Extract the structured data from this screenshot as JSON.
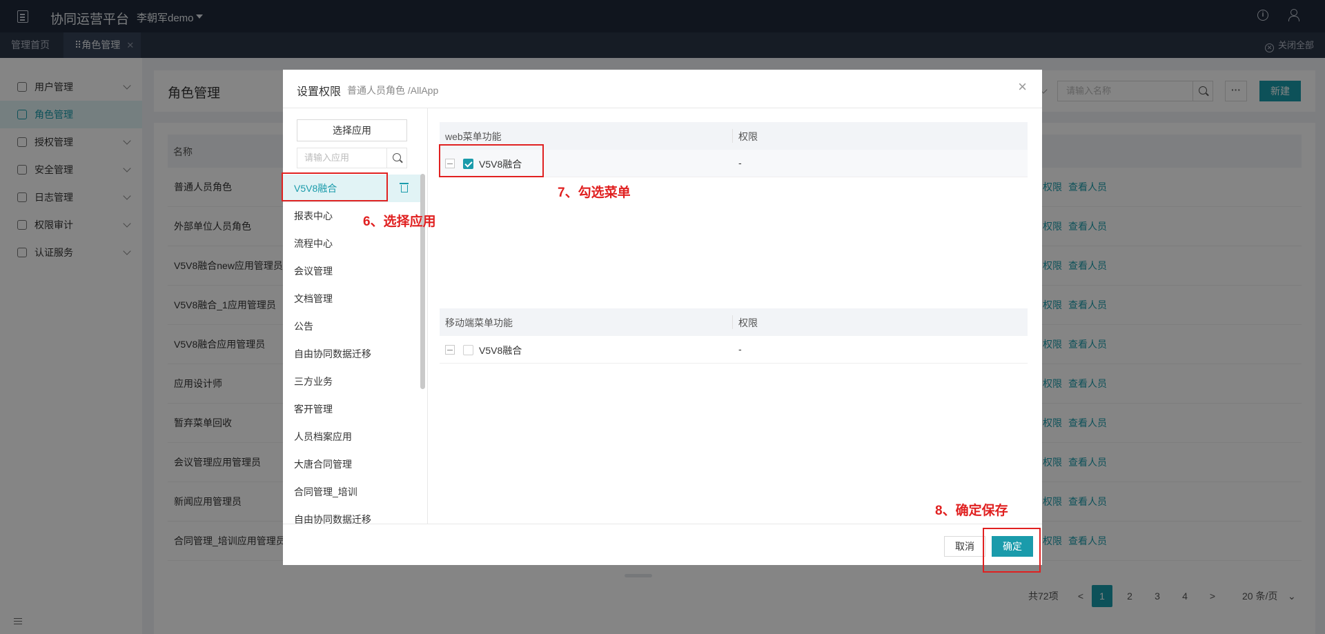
{
  "topbar": {
    "app_title": "协同运营平台",
    "user_name": "李朝军demo",
    "info_icon": "info-circle-icon",
    "user_icon": "user-icon"
  },
  "tabs": {
    "home": "管理首页",
    "active": "角色管理",
    "close_all": "关闭全部"
  },
  "sidebar": {
    "items": [
      {
        "label": "用户管理",
        "icon": "user-icon"
      },
      {
        "label": "角色管理",
        "icon": "shield-icon"
      },
      {
        "label": "授权管理",
        "icon": "key-icon"
      },
      {
        "label": "安全管理",
        "icon": "shield-icon"
      },
      {
        "label": "日志管理",
        "icon": "monitor-icon"
      },
      {
        "label": "权限审计",
        "icon": "user-icon"
      },
      {
        "label": "认证服务",
        "icon": "badge-icon"
      }
    ]
  },
  "main": {
    "page_title": "角色管理",
    "search_placeholder": "请输入名称",
    "more_label": "···",
    "new_label": "新建",
    "column_name": "名称",
    "rows": [
      {
        "name": "普通人员角色",
        "perm": "权限",
        "view": "查看人员"
      },
      {
        "name": "外部单位人员角色",
        "perm": "权限",
        "view": "查看人员"
      },
      {
        "name": "V5V8融合new应用管理员",
        "perm": "权限",
        "view": "查看人员"
      },
      {
        "name": "V5V8融合_1应用管理员",
        "perm": "权限",
        "view": "查看人员"
      },
      {
        "name": "V5V8融合应用管理员",
        "perm": "权限",
        "view": "查看人员"
      },
      {
        "name": "应用设计师",
        "perm": "权限",
        "view": "查看人员"
      },
      {
        "name": "暂弃菜单回收",
        "perm": "权限",
        "view": "查看人员"
      },
      {
        "name": "会议管理应用管理员",
        "perm": "权限",
        "view": "查看人员"
      },
      {
        "name": "新闻应用管理员",
        "perm": "权限",
        "view": "查看人员"
      },
      {
        "name": "合同管理_培训应用管理员",
        "perm": "权限",
        "view": "查看人员"
      }
    ],
    "pager": {
      "total": "共72项",
      "prev": "<",
      "pages": [
        "1",
        "2",
        "3",
        "4"
      ],
      "current": "1",
      "next": ">",
      "page_size": "20 条/页"
    }
  },
  "modal": {
    "title": "设置权限",
    "subtitle": "普通人员角色 /AllApp",
    "close": "×",
    "select_app_label": "选择应用",
    "app_search_placeholder": "请输入应用",
    "apps": [
      {
        "label": "V5V8融合"
      },
      {
        "label": "报表中心"
      },
      {
        "label": "流程中心"
      },
      {
        "label": "会议管理"
      },
      {
        "label": "文档管理"
      },
      {
        "label": "公告"
      },
      {
        "label": "自由协同数据迁移"
      },
      {
        "label": "三方业务"
      },
      {
        "label": "客开管理"
      },
      {
        "label": "人员档案应用"
      },
      {
        "label": "大唐合同管理"
      },
      {
        "label": "合同管理_培训"
      },
      {
        "label": "自由协同数据迁移"
      }
    ],
    "web_menu": {
      "col1": "web菜单功能",
      "col2": "权限",
      "rows": [
        {
          "label": "V5V8融合",
          "value": "-",
          "checked": true
        }
      ]
    },
    "mobile_menu": {
      "col1": "移动端菜单功能",
      "col2": "权限",
      "rows": [
        {
          "label": "V5V8融合",
          "value": "-",
          "checked": false
        }
      ]
    },
    "cancel_label": "取消",
    "ok_label": "确定"
  },
  "annotations": {
    "step6": "6、选择应用",
    "step7": "7、勾选菜单",
    "step8": "8、确定保存",
    "color": "#e02020"
  },
  "colors": {
    "accent": "#1a9bab",
    "topbar": "#1f2a3a"
  }
}
